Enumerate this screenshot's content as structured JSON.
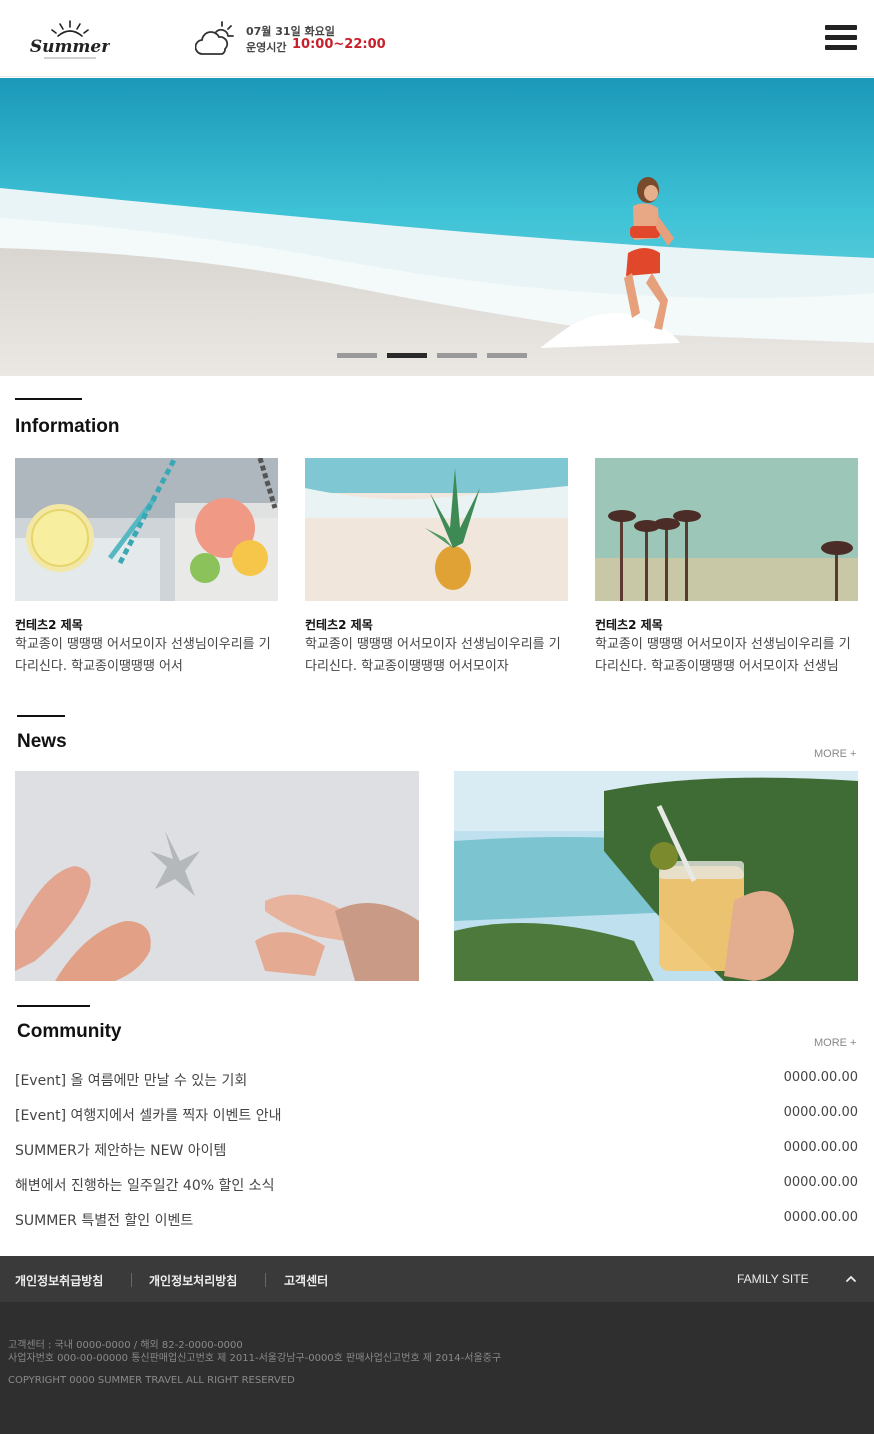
{
  "header": {
    "logo_text": "Summer",
    "date": "07월 31일 화요일",
    "hours_label": "운영시간",
    "hours_value": "10:00~22:00"
  },
  "hero": {
    "slides": 4,
    "active_slide": 2
  },
  "information": {
    "title": "Information",
    "cards": [
      {
        "title": "컨테츠2 제목",
        "desc": "학교종이 땡땡땡 어서모이자 선생님이우리를 기다리신다. 학교종이땡땡땡 어서"
      },
      {
        "title": "컨테츠2 제목",
        "desc": "학교종이 땡땡땡 어서모이자 선생님이우리를 기다리신다. 학교종이땡땡땡 어서모이자"
      },
      {
        "title": "컨테츠2 제목",
        "desc": "학교종이 땡땡땡 어서모이자 선생님이우리를 기다리신다. 학교종이땡땡땡 어서모이자 선생님"
      }
    ]
  },
  "news": {
    "title": "News",
    "more": "MORE +"
  },
  "community": {
    "title": "Community",
    "more": "MORE +",
    "items": [
      {
        "title": "[Event] 올 여름에만 만날 수 있는 기회",
        "date": "0000.00.00"
      },
      {
        "title": "[Event] 여행지에서 셀카를 찍자 이벤트 안내",
        "date": "0000.00.00"
      },
      {
        "title": "SUMMER가 제안하는 NEW 아이템",
        "date": "0000.00.00"
      },
      {
        "title": "해변에서 진행하는 일주일간 40% 할인 소식",
        "date": "0000.00.00"
      },
      {
        "title": "SUMMER 특별전 할인 이벤트",
        "date": "0000.00.00"
      }
    ]
  },
  "footer": {
    "links": [
      "개인정보취급방침",
      "개인정보처리방침",
      "고객센터"
    ],
    "family_site": "FAMILY SITE",
    "info_line1": "고객센터 : 국내 0000-0000 / 해외 82-2-0000-0000",
    "info_line2": "사업자번호 000-00-00000 통신판매업신고번호 제 2011-서울강남구-0000호 판매사업신고번호 제 2014-서울중구",
    "copyright": "COPYRIGHT 0000 SUMMER TRAVEL ALL RIGHT RESERVED"
  },
  "colors": {
    "accent": "#c8202b",
    "footer_top": "#3a3a3a",
    "footer_bottom": "#2f2f2f"
  },
  "icons": {
    "weather": "cloud-sun-icon",
    "menu": "hamburger-icon",
    "footer_up": "chevron-up-icon"
  }
}
